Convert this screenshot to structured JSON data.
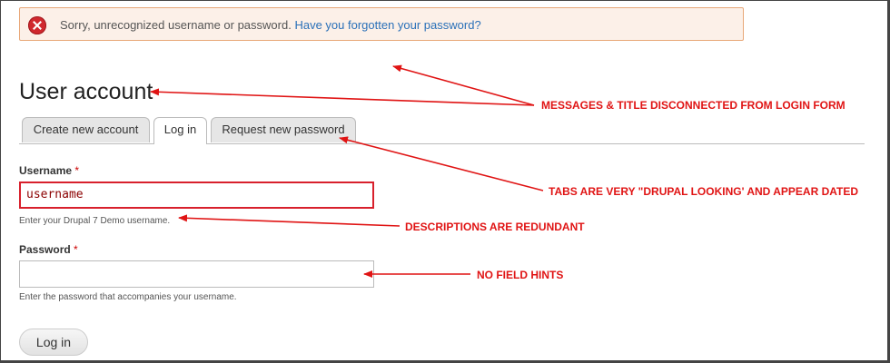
{
  "message": {
    "text": "Sorry, unrecognized username or password.",
    "link": "Have you forgotten your password?"
  },
  "page_title": "User account",
  "tabs": [
    {
      "label": "Create new account",
      "active": false
    },
    {
      "label": "Log in",
      "active": true
    },
    {
      "label": "Request new password",
      "active": false
    }
  ],
  "form": {
    "username_label": "Username",
    "username_value": "username",
    "username_desc": "Enter your Drupal 7 Demo username.",
    "password_label": "Password",
    "password_value": "",
    "password_desc": "Enter the password that accompanies your username.",
    "required_mark": "*",
    "submit_label": "Log in"
  },
  "annotations": [
    "MESSAGES & TITLE DISCONNECTED FROM LOGIN FORM",
    "TABS ARE VERY \"DRUPAL LOOKING' AND APPEAR DATED",
    "DESCRIPTIONS ARE REDUNDANT",
    "NO FIELD HINTS"
  ],
  "colors": {
    "error_red": "#d0282e",
    "annotation_red": "#e01414",
    "link_blue": "#2a70b8",
    "message_bg": "#fcf0e8"
  }
}
